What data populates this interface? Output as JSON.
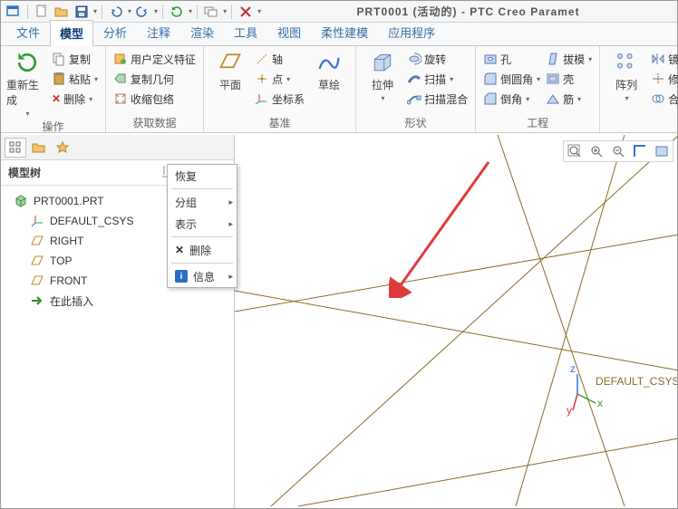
{
  "title": "PRT0001 (活动的) - PTC Creo Paramet",
  "tabs": [
    "文件",
    "模型",
    "分析",
    "注释",
    "渲染",
    "工具",
    "视图",
    "柔性建模",
    "应用程序"
  ],
  "activeTab": 1,
  "ribbon": {
    "g0": {
      "title": "操作",
      "regen": "重新生成",
      "copy": "复制",
      "paste": "粘贴",
      "del": "删除"
    },
    "g1": {
      "title": "获取数据",
      "udf": "用户定义特征",
      "copygeom": "复制几何",
      "shrink": "收缩包络"
    },
    "g2": {
      "title": "基准",
      "plane": "平面",
      "sketch": "草绘",
      "axis": "轴",
      "point": "点",
      "csys": "坐标系"
    },
    "g3": {
      "title": "形状",
      "extrude": "拉伸",
      "revolve": "旋转",
      "sweep": "扫描",
      "blend": "扫描混合"
    },
    "g4": {
      "title": "工程",
      "hole": "孔",
      "round": "倒圆角",
      "chamfer": "倒角",
      "draft": "拔模",
      "shell": "壳",
      "rib": "筋"
    },
    "g5": {
      "title": "",
      "pattern": "阵列",
      "mirror": "镜像",
      "trim": "修剪",
      "merge": "合并"
    }
  },
  "sidebar": {
    "treeTitle": "模型树",
    "root": "PRT0001.PRT",
    "csys": "DEFAULT_CSYS",
    "right": "RIGHT",
    "top": "TOP",
    "front": "FRONT",
    "insert": "在此插入"
  },
  "ctx": {
    "restore": "恢复",
    "group": "分组",
    "show": "表示",
    "delete": "删除",
    "info": "信息"
  },
  "canvas": {
    "csysLabel": "DEFAULT_CSYS"
  }
}
